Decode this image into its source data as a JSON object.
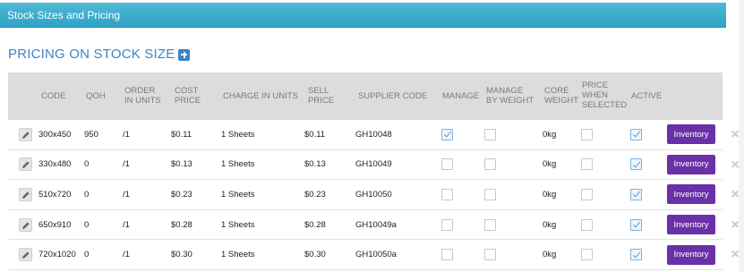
{
  "panel": {
    "title": "Stock Sizes and Pricing"
  },
  "page_title": "PRICING ON STOCK SIZE",
  "columns": {
    "code": "CODE",
    "qoh": "QOH",
    "order_in_units": [
      "ORDER",
      "IN UNITS"
    ],
    "cost_price": [
      "COST",
      "PRICE"
    ],
    "charge_in_units": "CHARGE IN UNITS",
    "sell_price": [
      "SELL",
      "PRICE"
    ],
    "supplier_code": "SUPPLIER CODE",
    "manage": "MANAGE",
    "manage_by_weight": [
      "MANAGE",
      "BY WEIGHT"
    ],
    "core_weight": [
      "CORE",
      "WEIGHT"
    ],
    "price_when_selected": [
      "PRICE",
      "WHEN",
      "SELECTED"
    ],
    "active": "ACTIVE"
  },
  "rows": [
    {
      "code": "300x450",
      "qoh": "950",
      "order_units": "/1",
      "cost": "$0.11",
      "charge": "1 Sheets",
      "sell": "$0.11",
      "supplier": "GH10048",
      "manage": true,
      "manage_by_weight": false,
      "core_weight": "0kg",
      "price_when_selected": false,
      "active": true,
      "inventory_label": "Inventory"
    },
    {
      "code": "330x480",
      "qoh": "0",
      "order_units": "/1",
      "cost": "$0.13",
      "charge": "1 Sheets",
      "sell": "$0.13",
      "supplier": "GH10049",
      "manage": false,
      "manage_by_weight": false,
      "core_weight": "0kg",
      "price_when_selected": false,
      "active": true,
      "inventory_label": "Inventory"
    },
    {
      "code": "510x720",
      "qoh": "0",
      "order_units": "/1",
      "cost": "$0.23",
      "charge": "1 Sheets",
      "sell": "$0.23",
      "supplier": "GH10050",
      "manage": false,
      "manage_by_weight": false,
      "core_weight": "0kg",
      "price_when_selected": false,
      "active": true,
      "inventory_label": "Inventory"
    },
    {
      "code": "650x910",
      "qoh": "0",
      "order_units": "/1",
      "cost": "$0.28",
      "charge": "1 Sheets",
      "sell": "$0.28",
      "supplier": "GH10049a",
      "manage": false,
      "manage_by_weight": false,
      "core_weight": "0kg",
      "price_when_selected": false,
      "active": true,
      "inventory_label": "Inventory"
    },
    {
      "code": "720x1020",
      "qoh": "0",
      "order_units": "/1",
      "cost": "$0.30",
      "charge": "1 Sheets",
      "sell": "$0.30",
      "supplier": "GH10050a",
      "manage": false,
      "manage_by_weight": false,
      "core_weight": "0kg",
      "price_when_selected": false,
      "active": true,
      "inventory_label": "Inventory"
    }
  ],
  "icons": {
    "edit": "pencil-icon",
    "add": "plus-icon",
    "delete": "close-icon"
  },
  "colors": {
    "header_bar": "#2fa2c6",
    "title": "#3b85c7",
    "inventory_button": "#6a30a8",
    "table_header": "#dcdcdc"
  }
}
